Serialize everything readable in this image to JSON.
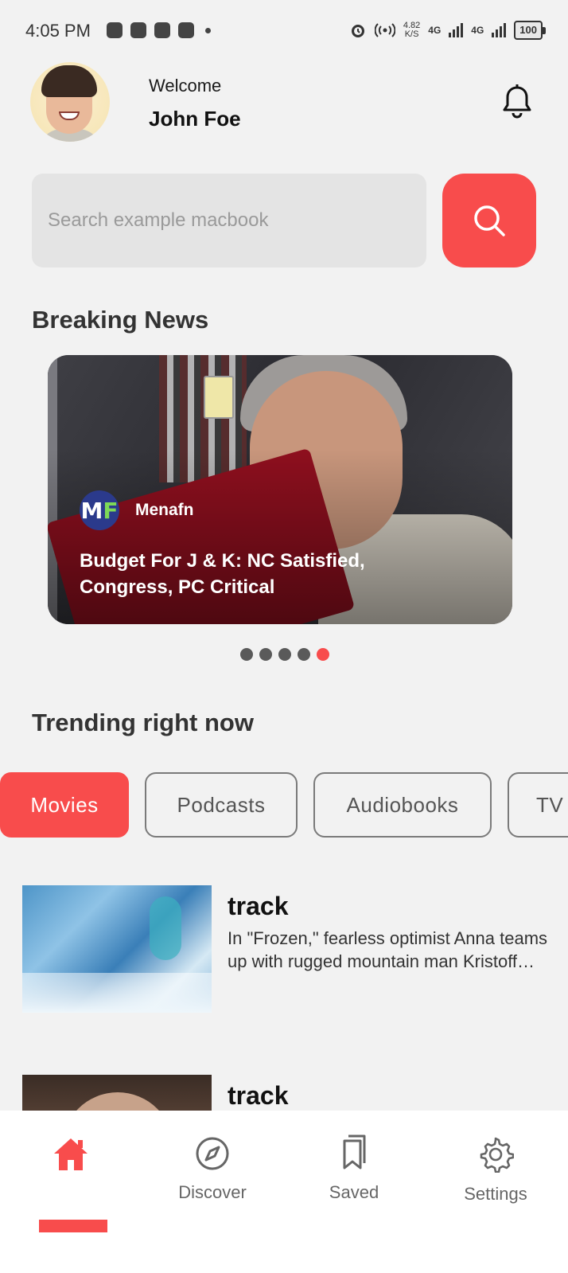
{
  "status_bar": {
    "time": "4:05 PM",
    "speed_value": "4.82",
    "speed_unit": "K/S",
    "network_1": "4G",
    "network_2": "4G",
    "battery": "100"
  },
  "header": {
    "welcome": "Welcome",
    "username": "John Foe"
  },
  "search": {
    "placeholder": "Search example macbook"
  },
  "breaking_news": {
    "title": "Breaking News",
    "source_logo_m": "M",
    "source_logo_f": "F",
    "source_name": "Menafn",
    "headline": "Budget For J & K: NC Satisfied, Congress, PC Critical",
    "slide_count": 5,
    "active_slide": 5
  },
  "trending": {
    "title": "Trending right now",
    "chips": [
      "Movies",
      "Podcasts",
      "Audiobooks",
      "TV"
    ],
    "active_chip": "Movies"
  },
  "tracks": [
    {
      "title": "track",
      "description": "In \"Frozen,\" fearless optimist Anna teams up with rugged mountain man Kristoff and his loyal reindeer Sven"
    },
    {
      "title": "track",
      "description": ""
    }
  ],
  "bottom_nav": {
    "home": "",
    "discover": "Discover",
    "saved": "Saved",
    "settings": "Settings"
  },
  "colors": {
    "accent": "#f84c4c",
    "background": "#f2f2f2",
    "search_field": "#e4e4e4"
  },
  "icons": {
    "notification": "bell-icon",
    "search": "search-icon",
    "home": "home-icon",
    "discover": "compass-icon",
    "saved": "bookmarks-icon",
    "settings": "gear-icon"
  }
}
